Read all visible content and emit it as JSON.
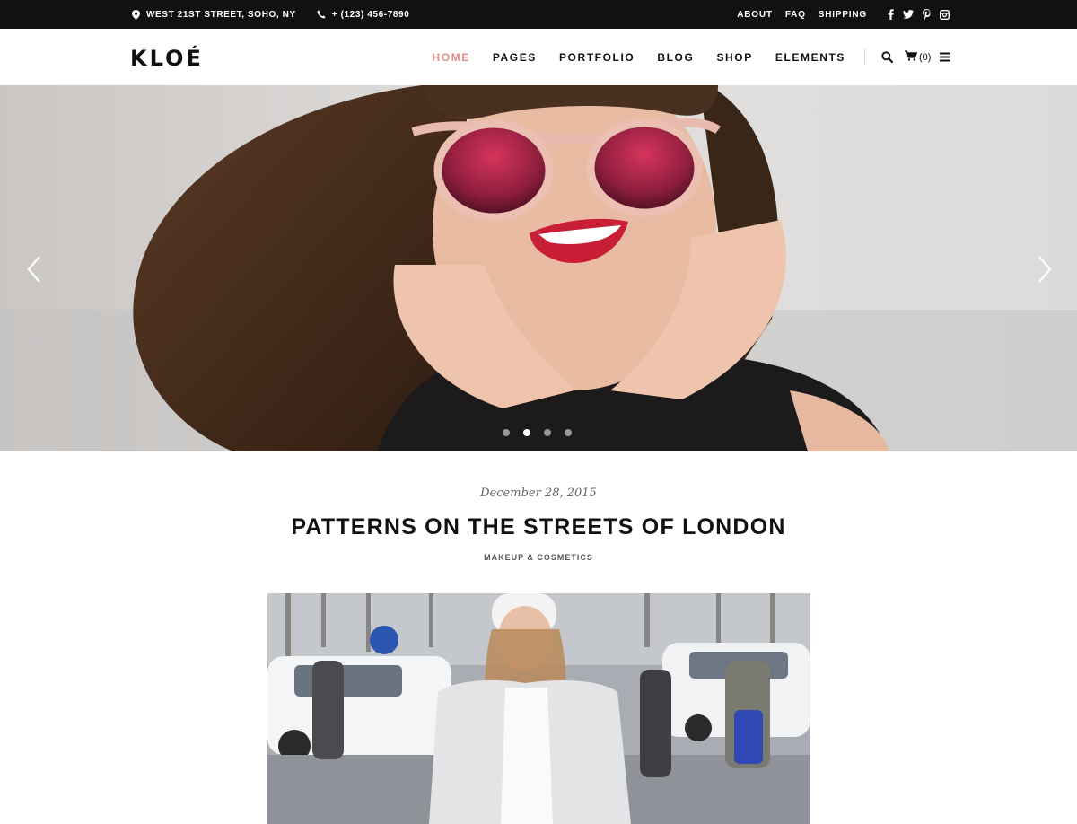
{
  "topbar": {
    "address": "WEST 21ST STREET, SOHO, NY",
    "phone": "+ (123) 456-7890",
    "links": [
      "ABOUT",
      "FAQ",
      "SHIPPING"
    ],
    "social_icons": [
      "facebook-icon",
      "twitter-icon",
      "pinterest-icon",
      "instagram-icon"
    ]
  },
  "header": {
    "logo": "KLOÉ",
    "nav": [
      "HOME",
      "PAGES",
      "PORTFOLIO",
      "BLOG",
      "SHOP",
      "ELEMENTS"
    ],
    "active_nav": "HOME",
    "cart_count": "(0)",
    "icons": [
      "search-icon",
      "cart-icon",
      "menu-icon"
    ]
  },
  "slider": {
    "slide_count": 4,
    "active_slide": 2
  },
  "post": {
    "date": "December 28, 2015",
    "title": "PATTERNS ON THE STREETS OF LONDON",
    "category": "MAKEUP & COSMETICS"
  },
  "colors": {
    "topbar_bg": "#111111",
    "accent": "#e58a84",
    "text": "#111111"
  }
}
